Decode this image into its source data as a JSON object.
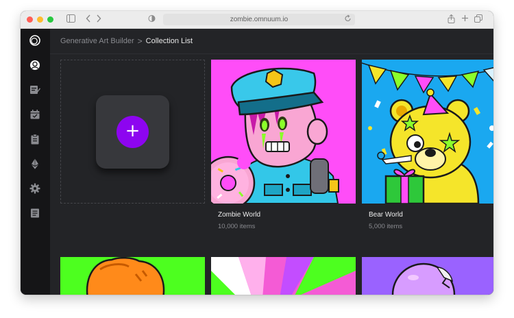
{
  "browser": {
    "url": "zombie.omnuum.io",
    "traffic_lights": [
      "#ff5f57",
      "#febc2e",
      "#28c840"
    ]
  },
  "sidebar": {
    "items": [
      {
        "icon": "omnuum-logo-icon"
      },
      {
        "icon": "user-circle-icon"
      },
      {
        "icon": "edit-note-icon"
      },
      {
        "icon": "calendar-icon"
      },
      {
        "icon": "clipboard-icon"
      },
      {
        "icon": "ethereum-icon"
      },
      {
        "icon": "gear-icon"
      },
      {
        "icon": "document-list-icon"
      }
    ]
  },
  "breadcrumb": {
    "parent": "Generative Art Builder",
    "separator": ">",
    "current": "Collection List"
  },
  "add_collection": {
    "label": "+",
    "accent": "#8d05f0"
  },
  "collections": [
    {
      "name": "Zombie World",
      "count": "10,000 items",
      "bg": "#ff4df8"
    },
    {
      "name": "Bear World",
      "count": "5,000 items",
      "bg": "#1aa8f0"
    }
  ],
  "second_row_tiles": [
    {
      "bg": "#4dff1f"
    },
    {
      "bg": "#f45bd5"
    },
    {
      "bg": "#9a62ff"
    }
  ]
}
